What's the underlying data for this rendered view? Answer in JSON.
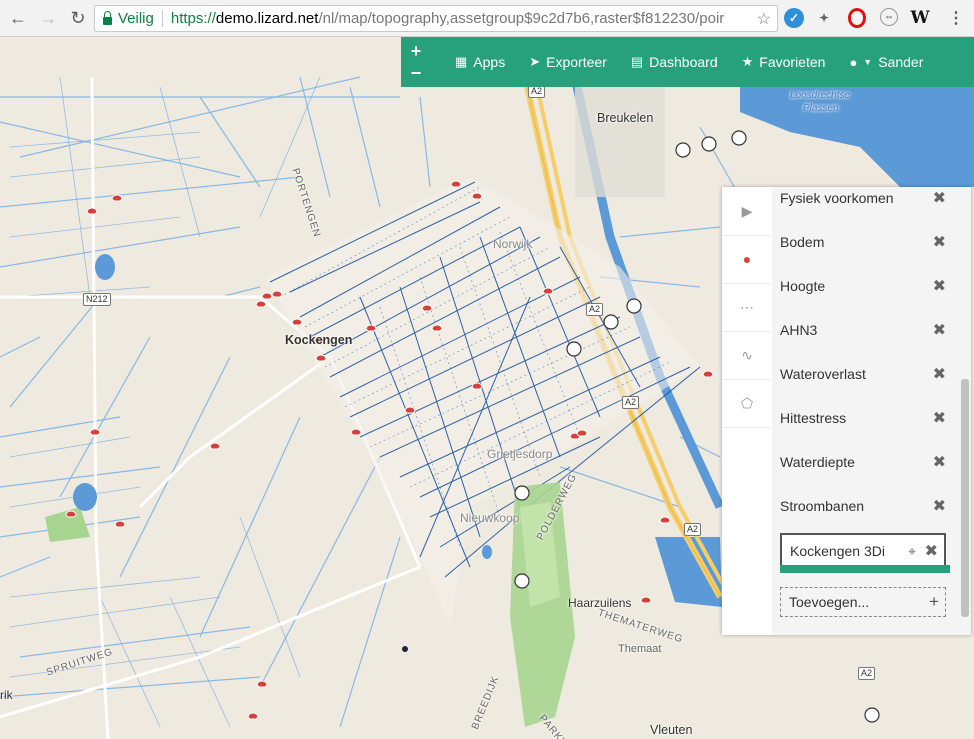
{
  "browser": {
    "secure_label": "Veilig",
    "url_scheme": "https://",
    "url_host": "demo.lizard.net",
    "url_path": "/nl/map/topography,assetgroup$9c2d7b6,raster$f812230/poir",
    "back_icon": "arrow-left-icon",
    "forward_icon": "arrow-right-icon",
    "reload_icon": "reload-icon",
    "bookmark_icon": "star-icon"
  },
  "topbar": {
    "zoom_in": "+",
    "zoom_out": "−",
    "apps_label": "Apps",
    "export_label": "Exporteer",
    "dashboard_label": "Dashboard",
    "favorites_label": "Favorieten",
    "user_label": "Sander",
    "color": "#26a17c"
  },
  "map": {
    "places": {
      "breukelen": "Breukelen",
      "kockengen": "Kockengen",
      "harzuilens": "Haarzuilens",
      "themaat": "Themaat",
      "vleuten": "Vleuten",
      "portengen": "PORTENGEN",
      "thematerweg": "THEMATERWEG",
      "polderweg": "POLDERWEG",
      "spruitweg": "SPRUITWEG",
      "breedijk": "BREEDIJK",
      "parkweg": "PARKWEG",
      "loosdrechtse": "Loosdrechtse",
      "plassen": "Plassen",
      "rik": "rik",
      "grietjesdorp": "Grietjesdorp",
      "nieuwkoop": "Nieuwkoop",
      "norwijk": "Norwijk"
    },
    "roads": {
      "n212": "N212",
      "a2": "A2"
    }
  },
  "panel": {
    "layers": [
      {
        "label": "Fysiek voorkomen"
      },
      {
        "label": "Bodem"
      },
      {
        "label": "Hoogte"
      },
      {
        "label": "AHN3"
      },
      {
        "label": "Wateroverlast"
      },
      {
        "label": "Hittestress"
      },
      {
        "label": "Waterdiepte"
      },
      {
        "label": "Stroombanen"
      }
    ],
    "active_layer": "Kockengen 3Di",
    "add_label": "Toevoegen...",
    "remove_glyph": "✖",
    "add_glyph": "+",
    "icons": [
      "play-icon",
      "map-marker-icon",
      "markers-icon",
      "line-chart-icon",
      "polygon-icon"
    ]
  }
}
